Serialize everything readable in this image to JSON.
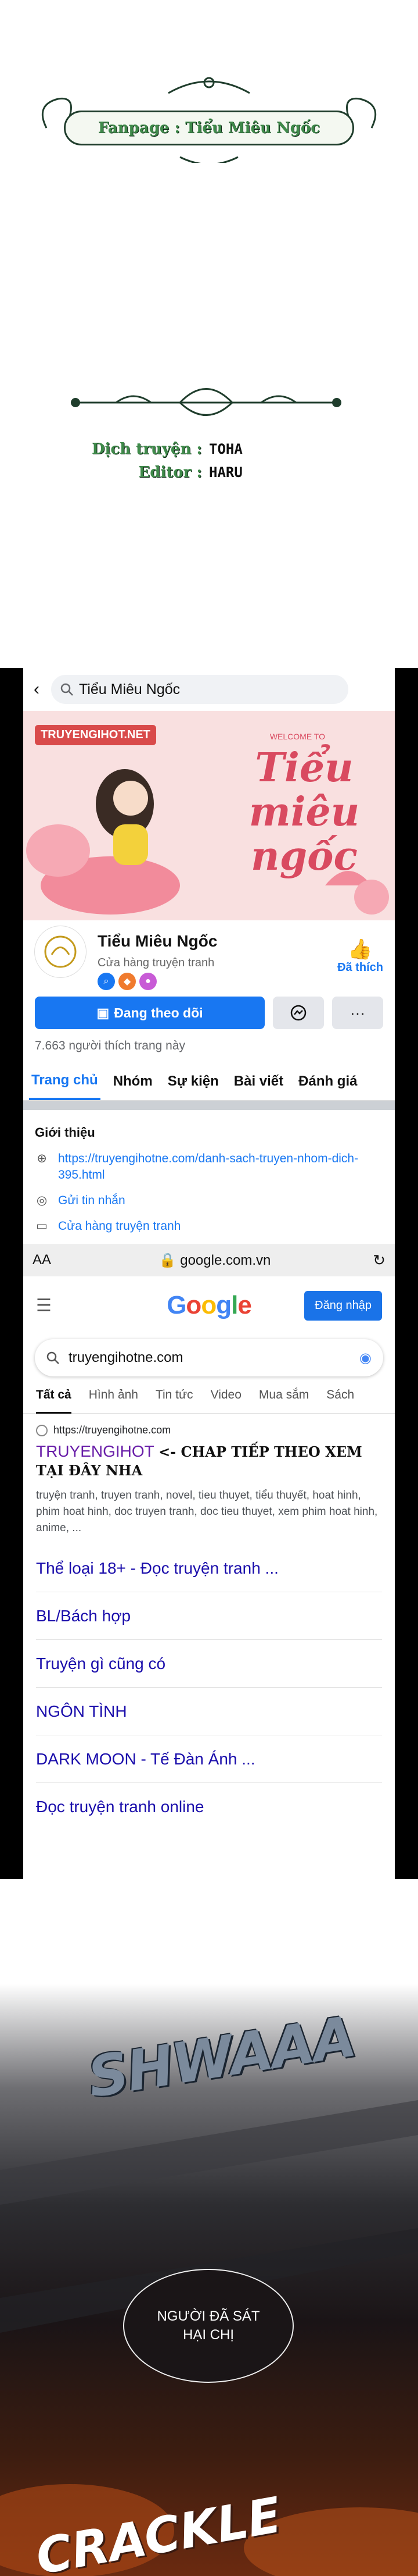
{
  "header": {
    "fanpage_banner": "Fanpage : Tiểu Miêu Ngốc",
    "credits": [
      {
        "label": "Dịch truyện :",
        "value": "TOHA"
      },
      {
        "label": "Editor :",
        "value": "HARU"
      }
    ]
  },
  "facebook": {
    "search_text": "Tiểu Miêu Ngốc",
    "cover": {
      "site_badge": "TRUYENGIHOT.NET",
      "welcome": "WELCOME TO",
      "script_title": "Tiểu miêu ngốc"
    },
    "page_name": "Tiểu Miêu Ngốc",
    "category": "Cửa hàng truyện tranh",
    "liked_label": "Đã thích",
    "follow_button": "Đang theo dõi",
    "messenger_icon": "messenger-icon",
    "more_label": "···",
    "likes_count": "7.663 người thích trang này",
    "tabs": [
      "Trang chủ",
      "Nhóm",
      "Sự kiện",
      "Bài viết",
      "Đánh giá"
    ],
    "intro": {
      "title": "Giới thiệu",
      "link": "https://truyengihotne.com/danh-sach-truyen-nhom-dich-395.html",
      "message": "Gửi tin nhắn",
      "category": "Cửa hàng truyện tranh"
    }
  },
  "browser": {
    "aa": "AA",
    "url": "google.com.vn",
    "google_logo": "Google",
    "sign_in": "Đăng nhập",
    "query": "truyengihotne.com",
    "tabs": [
      "Tất cả",
      "Hình ảnh",
      "Tin tức",
      "Video",
      "Mua sắm",
      "Sách"
    ],
    "result": {
      "url": "https://truyengihotne.com",
      "title": "TRUYENGIHOT",
      "note": "<- CHAP TIẾP THEO XEM TẠI ĐÂY NHA",
      "snippet": "truyện tranh, truyen tranh, novel, tieu thuyet, tiểu thuyết, hoat hinh, phim hoat hinh, doc truyen tranh, doc tieu thuyet, xem phim hoat hinh, anime, ..."
    },
    "sitelinks": [
      "Thể loại 18+ - Đọc truyện tranh ...",
      "BL/Bách hợp",
      "Truyện gì cũng có",
      "NGÔN TÌNH",
      "DARK MOON - Tế Đàn Ánh ...",
      "Đọc truyện tranh online"
    ],
    "colors": {
      "google_blue": "#4285f4",
      "google_red": "#ea4335",
      "google_yellow": "#fbbc05",
      "google_green": "#34a853"
    }
  },
  "comic": {
    "sfx_top": "SHWAAA",
    "bubble": "NGƯỜI ĐÃ SÁT HẠI CHỊ",
    "sfx_bottom": "CRACKLE"
  }
}
